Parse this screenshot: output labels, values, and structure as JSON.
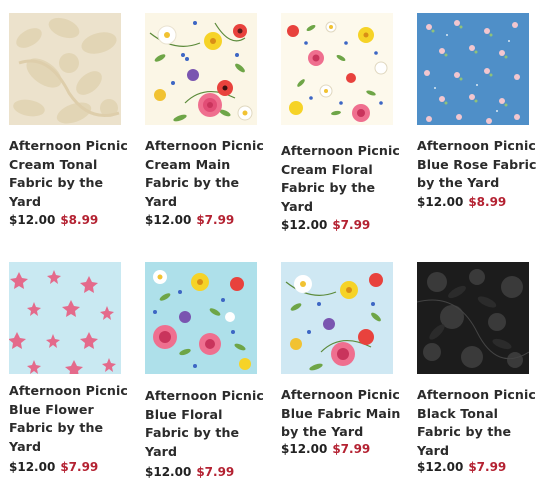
{
  "products": [
    {
      "title_lines": [
        "Afternoon Picnic",
        "Cream Tonal",
        "Fabric by the",
        "Yard"
      ],
      "price": "$12.00",
      "sale_price": "$8.99",
      "swatch": "cream-tonal"
    },
    {
      "title_lines": [
        "Afternoon Picnic",
        "Cream Main",
        "Fabric by the",
        "Yard"
      ],
      "price": "$12.00",
      "sale_price": "$7.99",
      "swatch": "cream-main"
    },
    {
      "title_lines": [
        "Afternoon Picnic",
        "Cream Floral",
        "Fabric by the",
        "Yard"
      ],
      "price": "$12.00",
      "sale_price": "$7.99",
      "swatch": "cream-floral"
    },
    {
      "title_lines": [
        "Afternoon Picnic",
        "Blue Rose Fabric",
        "by the Yard"
      ],
      "price": "$12.00",
      "sale_price": "$8.99",
      "swatch": "blue-rose"
    },
    {
      "title_lines": [
        "Afternoon Picnic",
        "Blue Flower",
        "Fabric by the",
        "Yard"
      ],
      "price": "$12.00",
      "sale_price": "$7.99",
      "swatch": "blue-flower"
    },
    {
      "title_lines": [
        "Afternoon Picnic",
        "Blue Floral",
        "Fabric by the",
        "Yard"
      ],
      "price": "$12.00",
      "sale_price": "$7.99",
      "swatch": "blue-floral"
    },
    {
      "title_lines": [
        "Afternoon Picnic",
        "Blue Fabric Main",
        "by the Yard"
      ],
      "price": "$12.00",
      "sale_price": "$7.99",
      "swatch": "blue-main"
    },
    {
      "title_lines": [
        "Afternoon Picnic",
        "Black Tonal",
        "Fabric by the",
        "Yard"
      ],
      "price": "$12.00",
      "sale_price": "$7.99",
      "swatch": "black-tonal"
    }
  ],
  "colors": {
    "sale_price": "#b42232",
    "regular_price": "#222222",
    "title": "#2b2b2b"
  }
}
